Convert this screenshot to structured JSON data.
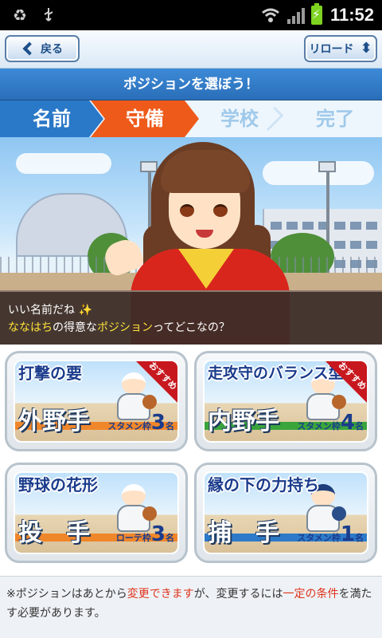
{
  "status_bar": {
    "time": "11:52",
    "left_icons": [
      "recycle-icon",
      "usb-icon"
    ],
    "right_icons": [
      "wifi-icon",
      "signal-icon",
      "battery-charging-icon"
    ]
  },
  "nav": {
    "back_label": "戻る",
    "reload_label": "リロード"
  },
  "title": "ポジションを選ぼう！",
  "steps": [
    {
      "label": "名前",
      "state": "done"
    },
    {
      "label": "守備",
      "state": "current"
    },
    {
      "label": "学校",
      "state": "todo"
    },
    {
      "label": "完了",
      "state": "todo"
    }
  ],
  "dialog": {
    "line1": "いい名前だね",
    "line2_name": "ななはち",
    "line2_mid": "の得意な",
    "line2_keyword": "ポジション",
    "line2_end": "ってどこなの？"
  },
  "cards": [
    {
      "catch": "打撃の要",
      "position": "外野手",
      "slot_label": "スタメン枠",
      "slot_count": "3",
      "slot_unit": "名",
      "badge": "おすすめ",
      "stripe": "orange"
    },
    {
      "catch": "走攻守のバランス型",
      "position": "内野手",
      "slot_label": "スタメン枠",
      "slot_count": "4",
      "slot_unit": "名",
      "badge": "おすすめ",
      "stripe": "green"
    },
    {
      "catch": "野球の花形",
      "position": "投　手",
      "slot_label": "ローテ枠",
      "slot_count": "3",
      "slot_unit": "名",
      "badge": "",
      "stripe": "orange"
    },
    {
      "catch": "縁の下の力持ち",
      "position": "捕　手",
      "slot_label": "スタメン枠",
      "slot_count": "1",
      "slot_unit": "名",
      "badge": "",
      "stripe": "blue"
    }
  ],
  "footnote": {
    "part1": "※ポジションはあとから",
    "highlight1": "変更できます",
    "part2": "が、変更するには",
    "highlight2": "一定の条件",
    "part3": "を満たす必要があります。"
  },
  "colors": {
    "step_done": "#2a78c8",
    "step_current": "#ee5a1a",
    "accent_yellow": "#ffe23a",
    "note_red": "#e0331c"
  }
}
